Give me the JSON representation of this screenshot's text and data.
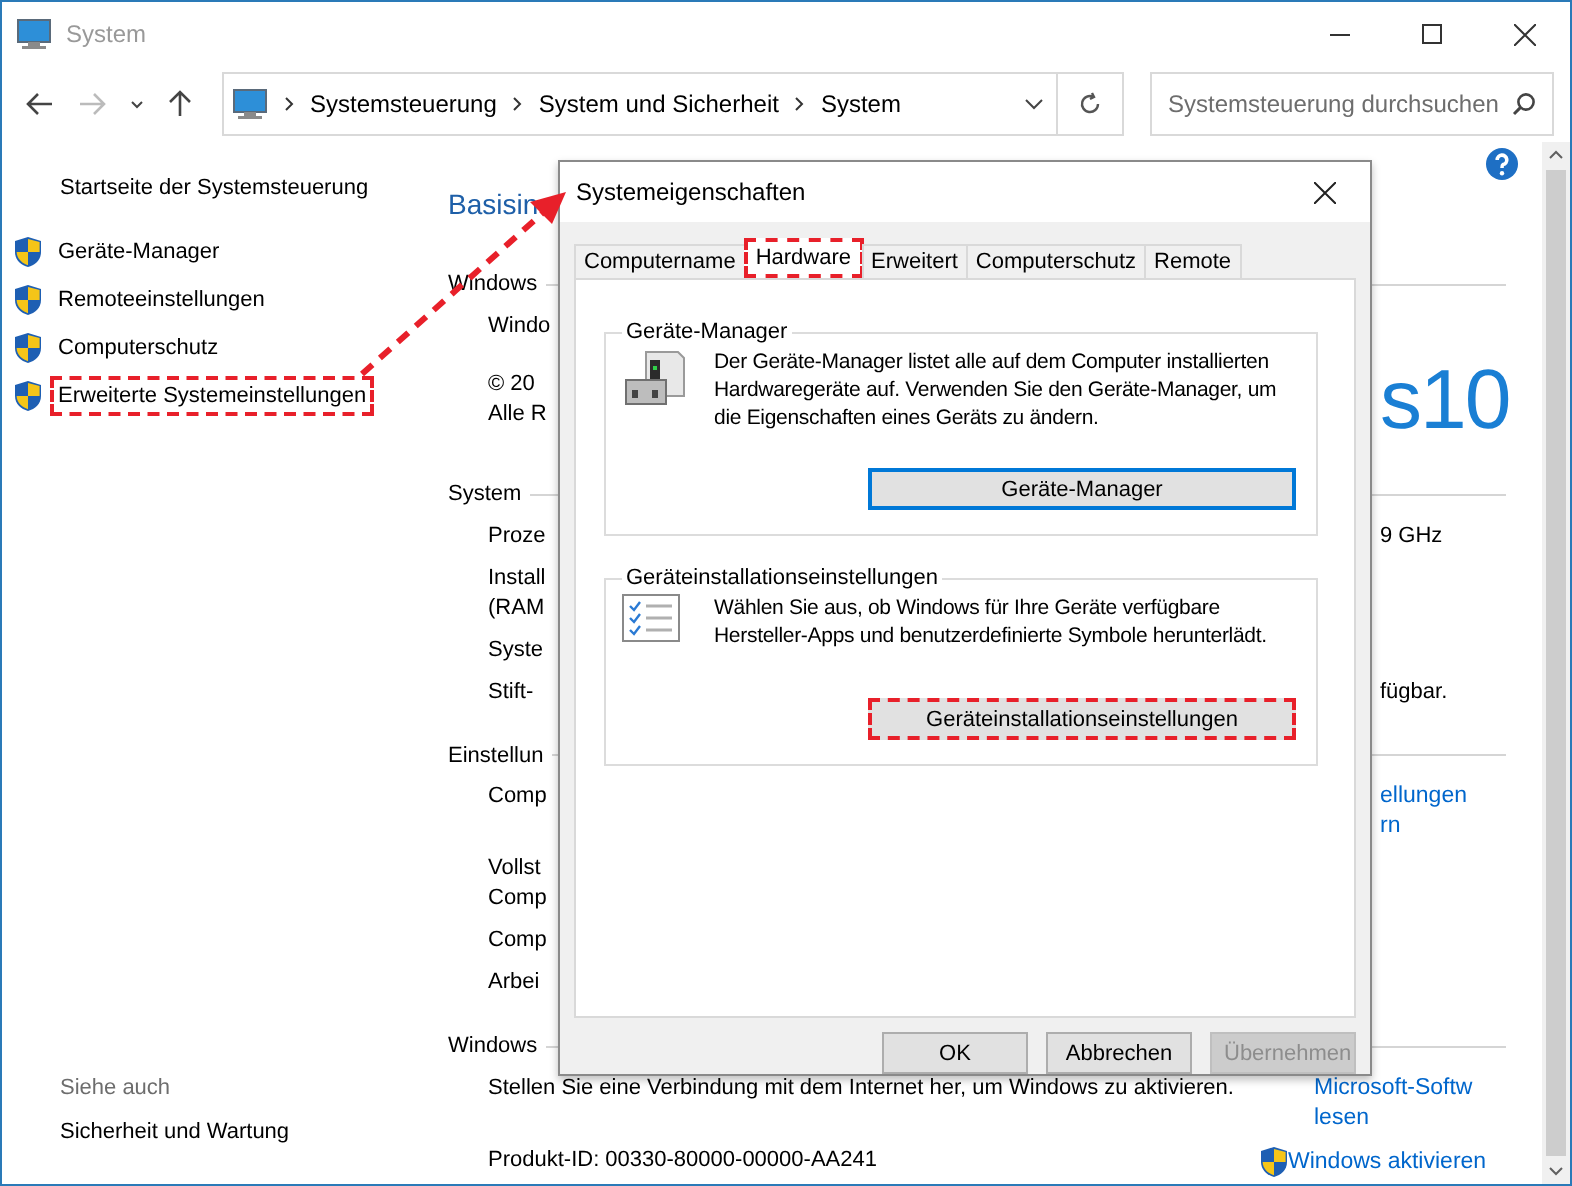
{
  "window": {
    "title": "System",
    "active": false
  },
  "address": {
    "crumbs": [
      "Systemsteuerung",
      "System und Sicherheit",
      "System"
    ],
    "search": {
      "placeholder": "Systemsteuerung durchsuchen"
    }
  },
  "sidebar": {
    "home": "Startseite der Systemsteuerung",
    "items": [
      {
        "label": "Geräte-Manager",
        "highlighted": false
      },
      {
        "label": "Remoteeinstellungen",
        "highlighted": false
      },
      {
        "label": "Computerschutz",
        "highlighted": false
      },
      {
        "label": "Erweiterte Systemeinstellungen",
        "highlighted": true
      }
    ],
    "see_also": {
      "title": "Siehe auch",
      "links": [
        "Sicherheit und Wartung"
      ]
    }
  },
  "main": {
    "title": "Basisin",
    "sections": [
      {
        "heading": "Windows",
        "rows": [
          {
            "left": [
              "Windo"
            ]
          },
          {
            "left": [
              "© 20",
              "Alle R"
            ],
            "right": {
              "kind": "logo",
              "text": "s10"
            }
          }
        ]
      },
      {
        "heading": "System",
        "rows": [
          {
            "left": [
              "Proze"
            ],
            "right": {
              "kind": "value",
              "text": "9 GHz"
            }
          },
          {
            "left": [
              "Install",
              "(RAM"
            ]
          },
          {
            "left": [
              "Syste"
            ]
          },
          {
            "left": [
              "Stift-"
            ],
            "right": {
              "kind": "value",
              "text": "fügbar."
            }
          }
        ]
      },
      {
        "heading": "Einstellun",
        "rows": [
          {
            "left": [
              "Comp"
            ],
            "right": {
              "kind": "link",
              "text": "ellungen\nrn"
            }
          },
          {
            "left": [
              "Vollst",
              "Comp"
            ]
          },
          {
            "left": [
              "Comp"
            ]
          },
          {
            "left": [
              "Arbei"
            ]
          }
        ]
      },
      {
        "heading": "Windows",
        "rows": [
          {
            "left": [
              "Stellen Sie eine Verbindung mit dem Internet her, um Windows zu aktivieren."
            ],
            "right": {
              "kind": "link",
              "text": "Microsoft-Softw\nlesen"
            }
          },
          {
            "left": [
              "Produkt-ID: 00330-80000-00000-AA241"
            ],
            "right": {
              "kind": "activate",
              "text": "Windows aktivieren"
            }
          }
        ]
      }
    ]
  },
  "dialog": {
    "title": "Systemeigenschaften",
    "tabs": [
      {
        "label": "Computername",
        "selected": false,
        "highlighted": false
      },
      {
        "label": "Hardware",
        "selected": true,
        "highlighted": true
      },
      {
        "label": "Erweitert",
        "selected": false,
        "highlighted": false
      },
      {
        "label": "Computerschutz",
        "selected": false,
        "highlighted": false
      },
      {
        "label": "Remote",
        "selected": false,
        "highlighted": false
      }
    ],
    "groups": [
      {
        "kind": "device",
        "title": "Geräte-Manager",
        "text": "Der Geräte-Manager listet alle auf dem Computer installierten Hardwaregeräte auf. Verwenden Sie den Geräte-Manager, um die Eigenschaften eines Geräts zu ändern.",
        "button": {
          "label": "Geräte-Manager",
          "focused": true,
          "highlighted": false
        }
      },
      {
        "kind": "checklist",
        "title": "Geräteinstallationseinstellungen",
        "text": "Wählen Sie aus, ob Windows für Ihre Geräte verfügbare Hersteller-Apps und benutzerdefinierte Symbole herunterlädt.",
        "button": {
          "label": "Geräteinstallationseinstellungen",
          "focused": false,
          "highlighted": true
        }
      }
    ],
    "buttons": [
      {
        "label": "OK",
        "disabled": false
      },
      {
        "label": "Abbrechen",
        "disabled": false
      },
      {
        "label": "Übernehmen",
        "disabled": true
      }
    ]
  }
}
